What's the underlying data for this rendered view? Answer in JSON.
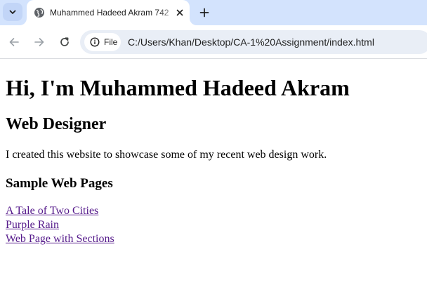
{
  "browser": {
    "tab": {
      "title": "Muhammed Hadeed Akram 742",
      "favicon": "globe-icon"
    },
    "address_bar": {
      "site_info_label": "File",
      "url": "C:/Users/Khan/Desktop/CA-1%20Assignment/index.html"
    },
    "icons": {
      "tab_search": "chevron-down-icon",
      "close_tab": "close-icon",
      "new_tab": "plus-icon",
      "back": "arrow-left-icon",
      "forward": "arrow-right-icon",
      "reload": "reload-icon",
      "site_info": "info-icon"
    },
    "colors": {
      "tabstrip_bg": "#d3e3fd",
      "omnibox_bg": "#e9eef6",
      "visited_link": "#551a8b"
    }
  },
  "page": {
    "heading": "Hi, I'm Muhammed Hadeed Akram",
    "subheading": "Web Designer",
    "intro": "I created this website to showcase some of my recent web design work.",
    "section_title": "Sample Web Pages",
    "links": [
      {
        "label": "A Tale of Two Cities"
      },
      {
        "label": "Purple Rain"
      },
      {
        "label": "Web Page with Sections"
      }
    ]
  }
}
